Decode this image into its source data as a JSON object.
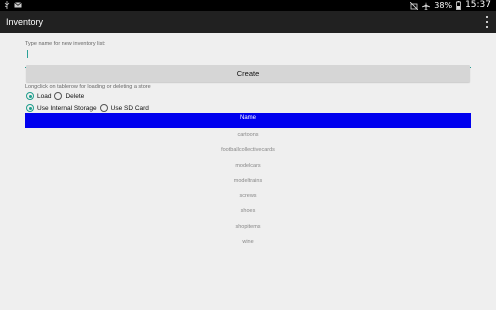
{
  "status_bar": {
    "battery": "38%",
    "time": "15:37",
    "left_icons": [
      "usb-icon",
      "mail-icon"
    ],
    "right_icons": [
      "mute-icon",
      "airplane-icon",
      "battery-icon"
    ]
  },
  "app_bar": {
    "title": "Inventory",
    "menu_icon": "overflow-menu-icon"
  },
  "form": {
    "input_hint": "Type name for new inventory list:",
    "input_value": "",
    "create_label": "Create",
    "longclick_hint": "Longclick on tablerow for loading or deleting a store"
  },
  "action_mode": {
    "options": [
      {
        "label": "Load",
        "checked": true
      },
      {
        "label": "Delete",
        "checked": false
      }
    ]
  },
  "storage_mode": {
    "options": [
      {
        "label": "Use Internal Storage",
        "checked": true
      },
      {
        "label": "Use SD Card",
        "checked": false
      }
    ]
  },
  "table": {
    "header": "Name",
    "header_color": "#0000ee",
    "rows": [
      "cartoons",
      "footballcollectivecards",
      "modelcars",
      "modeltrains",
      "screws",
      "shoes",
      "shopitems",
      "wine"
    ]
  }
}
